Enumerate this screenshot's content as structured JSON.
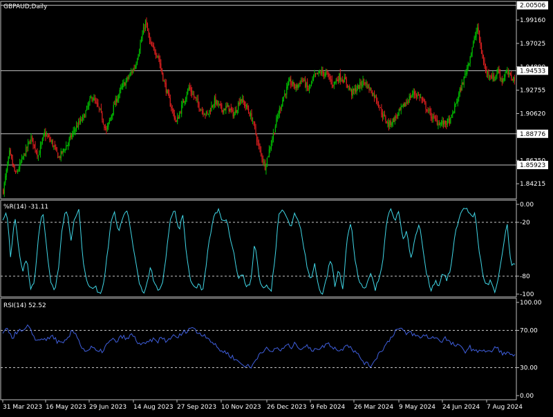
{
  "window": {
    "title": "GBPAUD,Daily"
  },
  "colors": {
    "background": "#000000",
    "bull": "#00c000",
    "bear": "#e02020",
    "wr_line": "#40d8e8",
    "rsi_line": "#4060e0",
    "level_line": "#c8c8c8",
    "frame": "#c0c0c0"
  },
  "chart_data": [
    {
      "type": "candlestick",
      "panel": "price",
      "title": "GBPAUD,Daily",
      "ylim": [
        1.829,
        2.008
      ],
      "y_ticks": [
        1.9916,
        1.97025,
        1.9489,
        1.92755,
        1.9062,
        1.88776,
        1.8635,
        1.84215
      ],
      "y_tick_labels": [
        "1.99160",
        "1.97025",
        "1.94890",
        "1.92755",
        "1.90620",
        "1.88776",
        "1.86350",
        "1.84215"
      ],
      "price_levels": [
        {
          "value": 2.00506,
          "label": "2.00506"
        },
        {
          "value": 1.94533,
          "label": "1.94533"
        },
        {
          "value": 1.88776,
          "label": "1.88776"
        },
        {
          "value": 1.85923,
          "label": "1.85923"
        }
      ],
      "current_price": {
        "value": 1.94533,
        "label": "1.94533"
      },
      "anchors": [
        [
          0,
          1.836
        ],
        [
          6,
          1.87
        ],
        [
          12,
          1.85
        ],
        [
          20,
          1.868
        ],
        [
          27,
          1.884
        ],
        [
          34,
          1.868
        ],
        [
          40,
          1.888
        ],
        [
          47,
          1.88
        ],
        [
          54,
          1.866
        ],
        [
          62,
          1.878
        ],
        [
          70,
          1.893
        ],
        [
          78,
          1.903
        ],
        [
          86,
          1.922
        ],
        [
          94,
          1.908
        ],
        [
          100,
          1.89
        ],
        [
          108,
          1.915
        ],
        [
          115,
          1.93
        ],
        [
          122,
          1.94
        ],
        [
          128,
          1.95
        ],
        [
          134,
          1.974
        ],
        [
          138,
          1.99
        ],
        [
          143,
          1.968
        ],
        [
          150,
          1.96
        ],
        [
          156,
          1.935
        ],
        [
          162,
          1.915
        ],
        [
          168,
          1.898
        ],
        [
          174,
          1.915
        ],
        [
          180,
          1.93
        ],
        [
          186,
          1.92
        ],
        [
          192,
          1.91
        ],
        [
          198,
          1.905
        ],
        [
          205,
          1.918
        ],
        [
          212,
          1.91
        ],
        [
          218,
          1.912
        ],
        [
          224,
          1.905
        ],
        [
          230,
          1.92
        ],
        [
          236,
          1.912
        ],
        [
          242,
          1.9
        ],
        [
          248,
          1.875
        ],
        [
          254,
          1.858
        ],
        [
          260,
          1.88
        ],
        [
          266,
          1.903
        ],
        [
          272,
          1.922
        ],
        [
          278,
          1.935
        ],
        [
          284,
          1.93
        ],
        [
          290,
          1.938
        ],
        [
          296,
          1.928
        ],
        [
          302,
          1.94
        ],
        [
          308,
          1.944
        ],
        [
          314,
          1.942
        ],
        [
          320,
          1.933
        ],
        [
          326,
          1.94
        ],
        [
          332,
          1.936
        ],
        [
          338,
          1.925
        ],
        [
          344,
          1.93
        ],
        [
          350,
          1.936
        ],
        [
          356,
          1.928
        ],
        [
          362,
          1.92
        ],
        [
          368,
          1.905
        ],
        [
          374,
          1.896
        ],
        [
          380,
          1.902
        ],
        [
          386,
          1.91
        ],
        [
          392,
          1.918
        ],
        [
          398,
          1.925
        ],
        [
          404,
          1.922
        ],
        [
          410,
          1.912
        ],
        [
          416,
          1.903
        ],
        [
          422,
          1.898
        ],
        [
          428,
          1.897
        ],
        [
          434,
          1.9
        ],
        [
          440,
          1.918
        ],
        [
          446,
          1.935
        ],
        [
          452,
          1.955
        ],
        [
          456,
          1.97
        ],
        [
          460,
          1.985
        ],
        [
          464,
          1.962
        ],
        [
          468,
          1.945
        ],
        [
          472,
          1.942
        ],
        [
          476,
          1.938
        ],
        [
          480,
          1.946
        ],
        [
          484,
          1.936
        ],
        [
          488,
          1.944
        ],
        [
          492,
          1.94
        ],
        [
          496,
          1.938
        ]
      ],
      "x_tick_labels": [
        "31 Mar 2023",
        "16 May 2023",
        "29 Jun 2023",
        "14 Aug 2023",
        "27 Sep 2023",
        "10 Nov 2023",
        "26 Dec 2023",
        "9 Feb 2024",
        "26 Mar 2024",
        "9 May 2024",
        "24 Jun 2024",
        "7 Aug 2024"
      ]
    },
    {
      "type": "line",
      "panel": "williams_r",
      "title": "%R(14) -31.11",
      "ylim": [
        -100,
        0
      ],
      "y_ticks": [
        0,
        -20,
        -80,
        -100
      ],
      "y_tick_labels": [
        "0.00",
        "-20",
        "-80",
        "-100"
      ],
      "levels": [
        -20,
        -80
      ],
      "anchors": [
        [
          0,
          -20
        ],
        [
          4,
          -5
        ],
        [
          8,
          -60
        ],
        [
          12,
          -10
        ],
        [
          16,
          -50
        ],
        [
          20,
          -75
        ],
        [
          24,
          -60
        ],
        [
          28,
          -95
        ],
        [
          32,
          -85
        ],
        [
          36,
          -30
        ],
        [
          40,
          -10
        ],
        [
          44,
          -50
        ],
        [
          48,
          -85
        ],
        [
          52,
          -95
        ],
        [
          56,
          -70
        ],
        [
          60,
          -20
        ],
        [
          64,
          -5
        ],
        [
          68,
          -40
        ],
        [
          72,
          -15
        ],
        [
          76,
          -3
        ],
        [
          80,
          -60
        ],
        [
          84,
          -85
        ],
        [
          88,
          -95
        ],
        [
          92,
          -90
        ],
        [
          96,
          -100
        ],
        [
          100,
          -95
        ],
        [
          104,
          -60
        ],
        [
          108,
          -20
        ],
        [
          112,
          -10
        ],
        [
          116,
          -30
        ],
        [
          120,
          -15
        ],
        [
          124,
          -5
        ],
        [
          128,
          -30
        ],
        [
          132,
          -60
        ],
        [
          136,
          -85
        ],
        [
          140,
          -100
        ],
        [
          144,
          -90
        ],
        [
          148,
          -70
        ],
        [
          152,
          -90
        ],
        [
          156,
          -98
        ],
        [
          160,
          -85
        ],
        [
          164,
          -50
        ],
        [
          168,
          -15
        ],
        [
          172,
          -5
        ],
        [
          176,
          -30
        ],
        [
          180,
          -10
        ],
        [
          184,
          -60
        ],
        [
          188,
          -85
        ],
        [
          192,
          -95
        ],
        [
          196,
          -90
        ],
        [
          200,
          -98
        ],
        [
          204,
          -60
        ],
        [
          208,
          -30
        ],
        [
          212,
          -10
        ],
        [
          216,
          -5
        ],
        [
          220,
          -20
        ],
        [
          224,
          -15
        ],
        [
          228,
          -40
        ],
        [
          232,
          -60
        ],
        [
          236,
          -85
        ],
        [
          240,
          -75
        ],
        [
          244,
          -95
        ],
        [
          248,
          -85
        ],
        [
          252,
          -40
        ],
        [
          256,
          -80
        ],
        [
          260,
          -95
        ],
        [
          264,
          -90
        ],
        [
          268,
          -99
        ],
        [
          272,
          -60
        ],
        [
          276,
          -10
        ],
        [
          280,
          -3
        ],
        [
          284,
          -15
        ],
        [
          288,
          -25
        ],
        [
          292,
          -10
        ],
        [
          296,
          -20
        ],
        [
          300,
          -40
        ],
        [
          304,
          -70
        ],
        [
          308,
          -85
        ],
        [
          312,
          -65
        ],
        [
          316,
          -95
        ],
        [
          320,
          -100
        ],
        [
          324,
          -80
        ],
        [
          328,
          -60
        ],
        [
          332,
          -90
        ],
        [
          336,
          -70
        ],
        [
          340,
          -95
        ],
        [
          344,
          -40
        ],
        [
          348,
          -20
        ],
        [
          352,
          -60
        ],
        [
          356,
          -85
        ],
        [
          360,
          -95
        ],
        [
          364,
          -90
        ],
        [
          368,
          -75
        ],
        [
          372,
          -95
        ],
        [
          376,
          -85
        ],
        [
          380,
          -60
        ],
        [
          384,
          -15
        ],
        [
          388,
          -5
        ],
        [
          392,
          -20
        ],
        [
          396,
          -5
        ],
        [
          400,
          -40
        ],
        [
          404,
          -30
        ],
        [
          408,
          -60
        ],
        [
          412,
          -40
        ],
        [
          416,
          -20
        ],
        [
          420,
          -50
        ],
        [
          424,
          -80
        ],
        [
          428,
          -95
        ],
        [
          432,
          -85
        ],
        [
          436,
          -90
        ],
        [
          440,
          -75
        ],
        [
          444,
          -85
        ],
        [
          448,
          -70
        ],
        [
          452,
          -35
        ],
        [
          456,
          -15
        ],
        [
          460,
          -5
        ],
        [
          464,
          -3
        ],
        [
          468,
          -15
        ],
        [
          472,
          -10
        ],
        [
          476,
          -50
        ],
        [
          480,
          -80
        ],
        [
          484,
          -90
        ],
        [
          488,
          -85
        ],
        [
          492,
          -100
        ],
        [
          496,
          -80
        ],
        [
          500,
          -50
        ],
        [
          504,
          -20
        ],
        [
          508,
          -70
        ],
        [
          512,
          -65
        ]
      ]
    },
    {
      "type": "line",
      "panel": "rsi",
      "title": "RSI(14) 52.52",
      "ylim": [
        0,
        100
      ],
      "y_ticks": [
        100,
        70,
        30,
        0
      ],
      "y_tick_labels": [
        "100.00",
        "70.00",
        "30.00",
        "0.00"
      ],
      "levels": [
        70,
        30
      ],
      "anchors": [
        [
          0,
          65
        ],
        [
          5,
          72
        ],
        [
          10,
          62
        ],
        [
          15,
          70
        ],
        [
          20,
          68
        ],
        [
          25,
          74
        ],
        [
          30,
          66
        ],
        [
          35,
          58
        ],
        [
          40,
          62
        ],
        [
          45,
          60
        ],
        [
          50,
          64
        ],
        [
          55,
          58
        ],
        [
          60,
          55
        ],
        [
          65,
          60
        ],
        [
          70,
          70
        ],
        [
          75,
          64
        ],
        [
          80,
          50
        ],
        [
          85,
          48
        ],
        [
          90,
          52
        ],
        [
          95,
          46
        ],
        [
          100,
          48
        ],
        [
          105,
          55
        ],
        [
          110,
          60
        ],
        [
          115,
          58
        ],
        [
          120,
          64
        ],
        [
          125,
          60
        ],
        [
          130,
          66
        ],
        [
          135,
          58
        ],
        [
          140,
          54
        ],
        [
          145,
          56
        ],
        [
          150,
          60
        ],
        [
          155,
          58
        ],
        [
          160,
          62
        ],
        [
          165,
          58
        ],
        [
          170,
          64
        ],
        [
          175,
          62
        ],
        [
          180,
          66
        ],
        [
          185,
          70
        ],
        [
          190,
          74
        ],
        [
          195,
          68
        ],
        [
          200,
          66
        ],
        [
          205,
          64
        ],
        [
          210,
          58
        ],
        [
          215,
          52
        ],
        [
          220,
          48
        ],
        [
          225,
          46
        ],
        [
          230,
          42
        ],
        [
          235,
          38
        ],
        [
          240,
          34
        ],
        [
          245,
          32
        ],
        [
          250,
          30
        ],
        [
          255,
          40
        ],
        [
          260,
          48
        ],
        [
          265,
          50
        ],
        [
          270,
          46
        ],
        [
          275,
          52
        ],
        [
          280,
          48
        ],
        [
          285,
          54
        ],
        [
          290,
          52
        ],
        [
          295,
          56
        ],
        [
          300,
          50
        ],
        [
          305,
          54
        ],
        [
          310,
          48
        ],
        [
          315,
          52
        ],
        [
          320,
          50
        ],
        [
          325,
          56
        ],
        [
          330,
          54
        ],
        [
          335,
          50
        ],
        [
          340,
          48
        ],
        [
          345,
          56
        ],
        [
          350,
          52
        ],
        [
          355,
          46
        ],
        [
          360,
          40
        ],
        [
          365,
          34
        ],
        [
          370,
          32
        ],
        [
          375,
          40
        ],
        [
          380,
          48
        ],
        [
          385,
          54
        ],
        [
          390,
          62
        ],
        [
          395,
          70
        ],
        [
          400,
          72
        ],
        [
          405,
          66
        ],
        [
          410,
          68
        ],
        [
          415,
          64
        ],
        [
          420,
          62
        ],
        [
          425,
          66
        ],
        [
          430,
          60
        ],
        [
          435,
          64
        ],
        [
          440,
          58
        ],
        [
          445,
          62
        ],
        [
          450,
          56
        ],
        [
          455,
          54
        ],
        [
          460,
          52
        ],
        [
          465,
          48
        ],
        [
          470,
          52
        ],
        [
          475,
          46
        ],
        [
          480,
          50
        ],
        [
          485,
          48
        ],
        [
          490,
          46
        ],
        [
          495,
          52
        ],
        [
          500,
          48
        ],
        [
          505,
          44
        ],
        [
          510,
          46
        ],
        [
          515,
          42
        ]
      ]
    }
  ]
}
